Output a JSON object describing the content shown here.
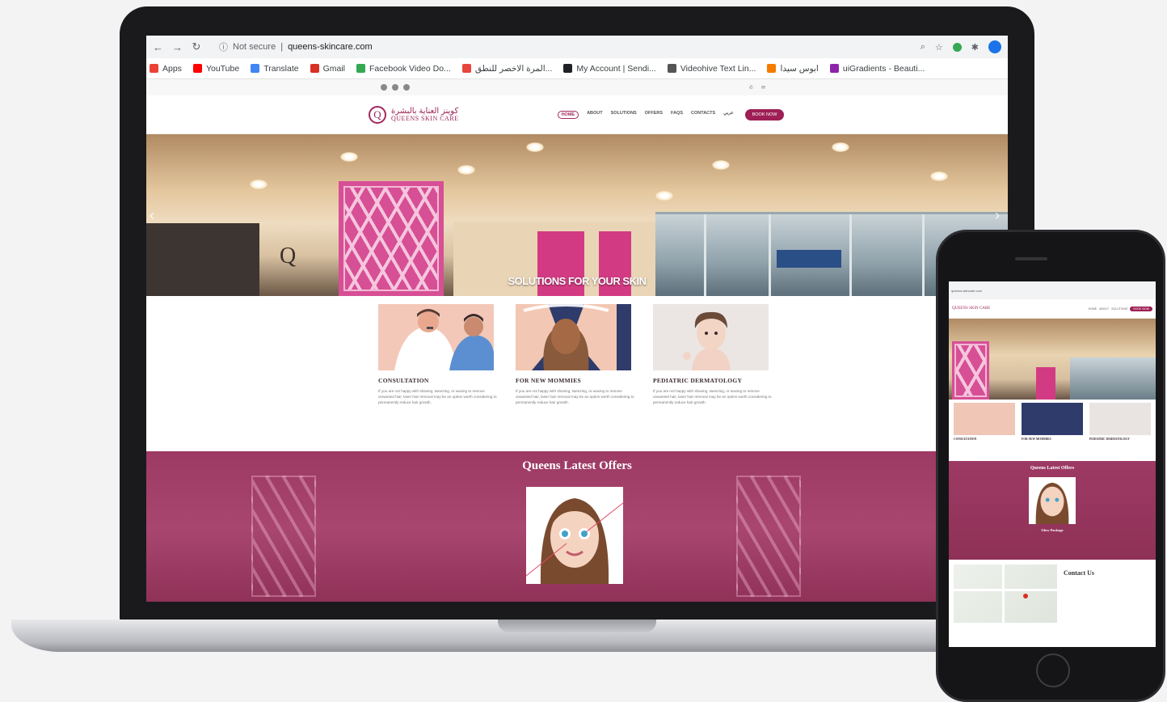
{
  "browser": {
    "security_label": "Not secure",
    "url": "queens-skincare.com",
    "bookmarks": [
      {
        "label": "Apps",
        "color": "#ea4335"
      },
      {
        "label": "YouTube",
        "color": "#ff0000"
      },
      {
        "label": "Translate",
        "color": "#4285f4"
      },
      {
        "label": "Gmail",
        "color": "#d93025"
      },
      {
        "label": "Facebook Video Do...",
        "color": "#34a853"
      },
      {
        "label": "المرة الاخصر للنطق...",
        "color": "#e8453c"
      },
      {
        "label": "My Account | Sendi...",
        "color": "#202124"
      },
      {
        "label": "Videohive Text Lin...",
        "color": "#555555"
      },
      {
        "label": "ابوس سيدا",
        "color": "#f57c00"
      },
      {
        "label": "uiGradients - Beauti...",
        "color": "#8e24aa"
      }
    ]
  },
  "site": {
    "logo_ar": "كوينز العناية بالبشرة",
    "logo_en": "QUEENS SKIN CARE",
    "nav": [
      "HOME",
      "ABOUT",
      "SOLUTIONS",
      "OFFERS",
      "FAQS",
      "CONTACTS",
      "عربي"
    ],
    "book_label": "BOOK NOW",
    "hero_caption": "SOLUTIONS FOR YOUR SKIN",
    "services": [
      {
        "title": "CONSULTATION",
        "text": "If you are not happy with shaving, tweezing, or waxing to remove unwanted hair, laser hair removal may be an option worth considering to permanently reduce hair growth."
      },
      {
        "title": "FOR NEW MOMMIES",
        "text": "If you are not happy with shaving, tweezing, or waxing to remove unwanted hair, laser hair removal may be an option worth considering to permanently reduce hair growth."
      },
      {
        "title": "PEDIATRIC DERMATOLOGY",
        "text": "If you are not happy with shaving, tweezing, or waxing to remove unwanted hair, laser hair removal may be an option worth considering to permanently reduce hair growth."
      }
    ],
    "offers_title": "Queens Latest Offers"
  },
  "mobile": {
    "offers_title": "Queens Latest Offers",
    "offer_name": "Glow Package",
    "contact_title": "Contact Us"
  },
  "colors": {
    "brand": "#9e1f55",
    "offers_bg": "#9d3a64"
  }
}
